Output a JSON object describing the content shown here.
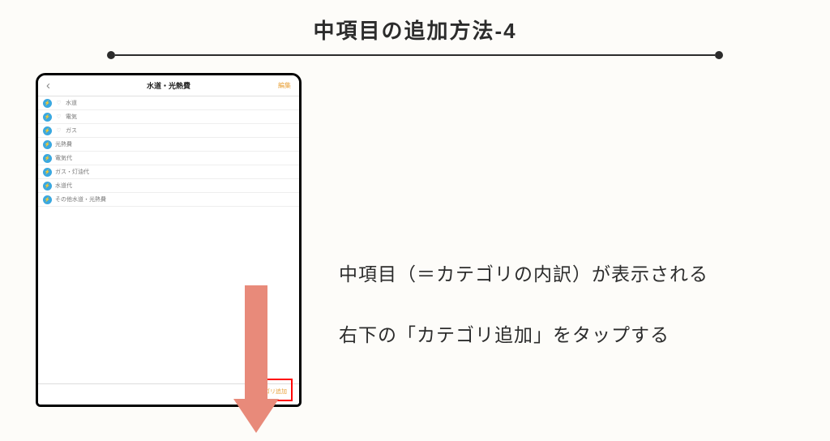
{
  "title": "中項目の追加方法-4",
  "phone": {
    "header": {
      "back_glyph": "‹",
      "title": "水道・光熱費",
      "edit": "編集"
    },
    "categories": [
      {
        "label": "水道",
        "has_heart": true
      },
      {
        "label": "電気",
        "has_heart": true
      },
      {
        "label": "ガス",
        "has_heart": true
      },
      {
        "label": "光熱費",
        "has_heart": false
      },
      {
        "label": "電気代",
        "has_heart": false
      },
      {
        "label": "ガス・灯油代",
        "has_heart": false
      },
      {
        "label": "水道代",
        "has_heart": false
      },
      {
        "label": "その他水道・光熱費",
        "has_heart": false
      }
    ],
    "footer": {
      "add_label": "カテゴリ追加"
    }
  },
  "description": {
    "line1": "中項目（＝カテゴリの内訳）が表示される",
    "line2": "右下の「カテゴリ追加」をタップする"
  }
}
